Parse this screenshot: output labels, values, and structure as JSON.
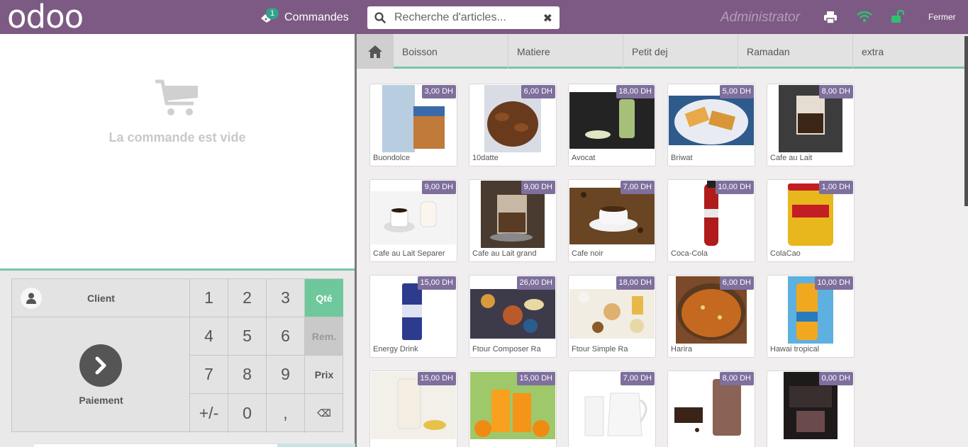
{
  "header": {
    "logo": "odoo",
    "orders_label": "Commandes",
    "orders_count": "1",
    "search_placeholder": "Recherche d'articles...",
    "clear_icon": "close-icon",
    "user": "Administrator",
    "close_label": "Fermer",
    "icons": [
      "printer-icon",
      "wifi-icon",
      "unlock-icon"
    ],
    "colors": {
      "bar": "#7c5a83",
      "wifi": "#2fbf71",
      "lock": "#2fbf71"
    }
  },
  "order": {
    "empty_message": "La commande est vide"
  },
  "pad": {
    "client_label": "Client",
    "payment_label": "Paiement",
    "keys": [
      "1",
      "2",
      "3",
      "Qté",
      "4",
      "5",
      "6",
      "Rem.",
      "7",
      "8",
      "9",
      "Prix",
      "+/-",
      "0",
      ",",
      "⌫"
    ],
    "active_mode": "Qté",
    "active_color": "#6ec89b"
  },
  "categories": {
    "home_icon": "home-icon",
    "items": [
      "Boisson",
      "Matiere",
      "Petit dej",
      "Ramadan",
      "extra"
    ]
  },
  "products": [
    {
      "name": "Buondolce",
      "price": "3,00 DH"
    },
    {
      "name": "10datte",
      "price": "6,00 DH"
    },
    {
      "name": "Avocat",
      "price": "18,00 DH"
    },
    {
      "name": "Briwat",
      "price": "5,00 DH"
    },
    {
      "name": "Cafe au Lait",
      "price": "8,00 DH"
    },
    {
      "name": "Cafe au Lait Separer",
      "price": "9,00 DH"
    },
    {
      "name": "Cafe au Lait grand",
      "price": "9,00 DH"
    },
    {
      "name": "Cafe noir",
      "price": "7,00 DH"
    },
    {
      "name": "Coca-Cola",
      "price": "10,00 DH"
    },
    {
      "name": "ColaCao",
      "price": "1,00 DH"
    },
    {
      "name": "Energy Drink",
      "price": "15,00 DH"
    },
    {
      "name": "Ftour Composer Ra",
      "price": "26,00 DH"
    },
    {
      "name": "Ftour Simple Ra",
      "price": "18,00 DH"
    },
    {
      "name": "Harira",
      "price": "6,00 DH"
    },
    {
      "name": "Hawai tropical",
      "price": "10,00 DH"
    },
    {
      "name": "",
      "price": "15,00 DH"
    },
    {
      "name": "",
      "price": "15,00 DH"
    },
    {
      "name": "",
      "price": "7,00 DH"
    },
    {
      "name": "",
      "price": "8,00 DH"
    },
    {
      "name": "",
      "price": "0,00 DH"
    }
  ]
}
